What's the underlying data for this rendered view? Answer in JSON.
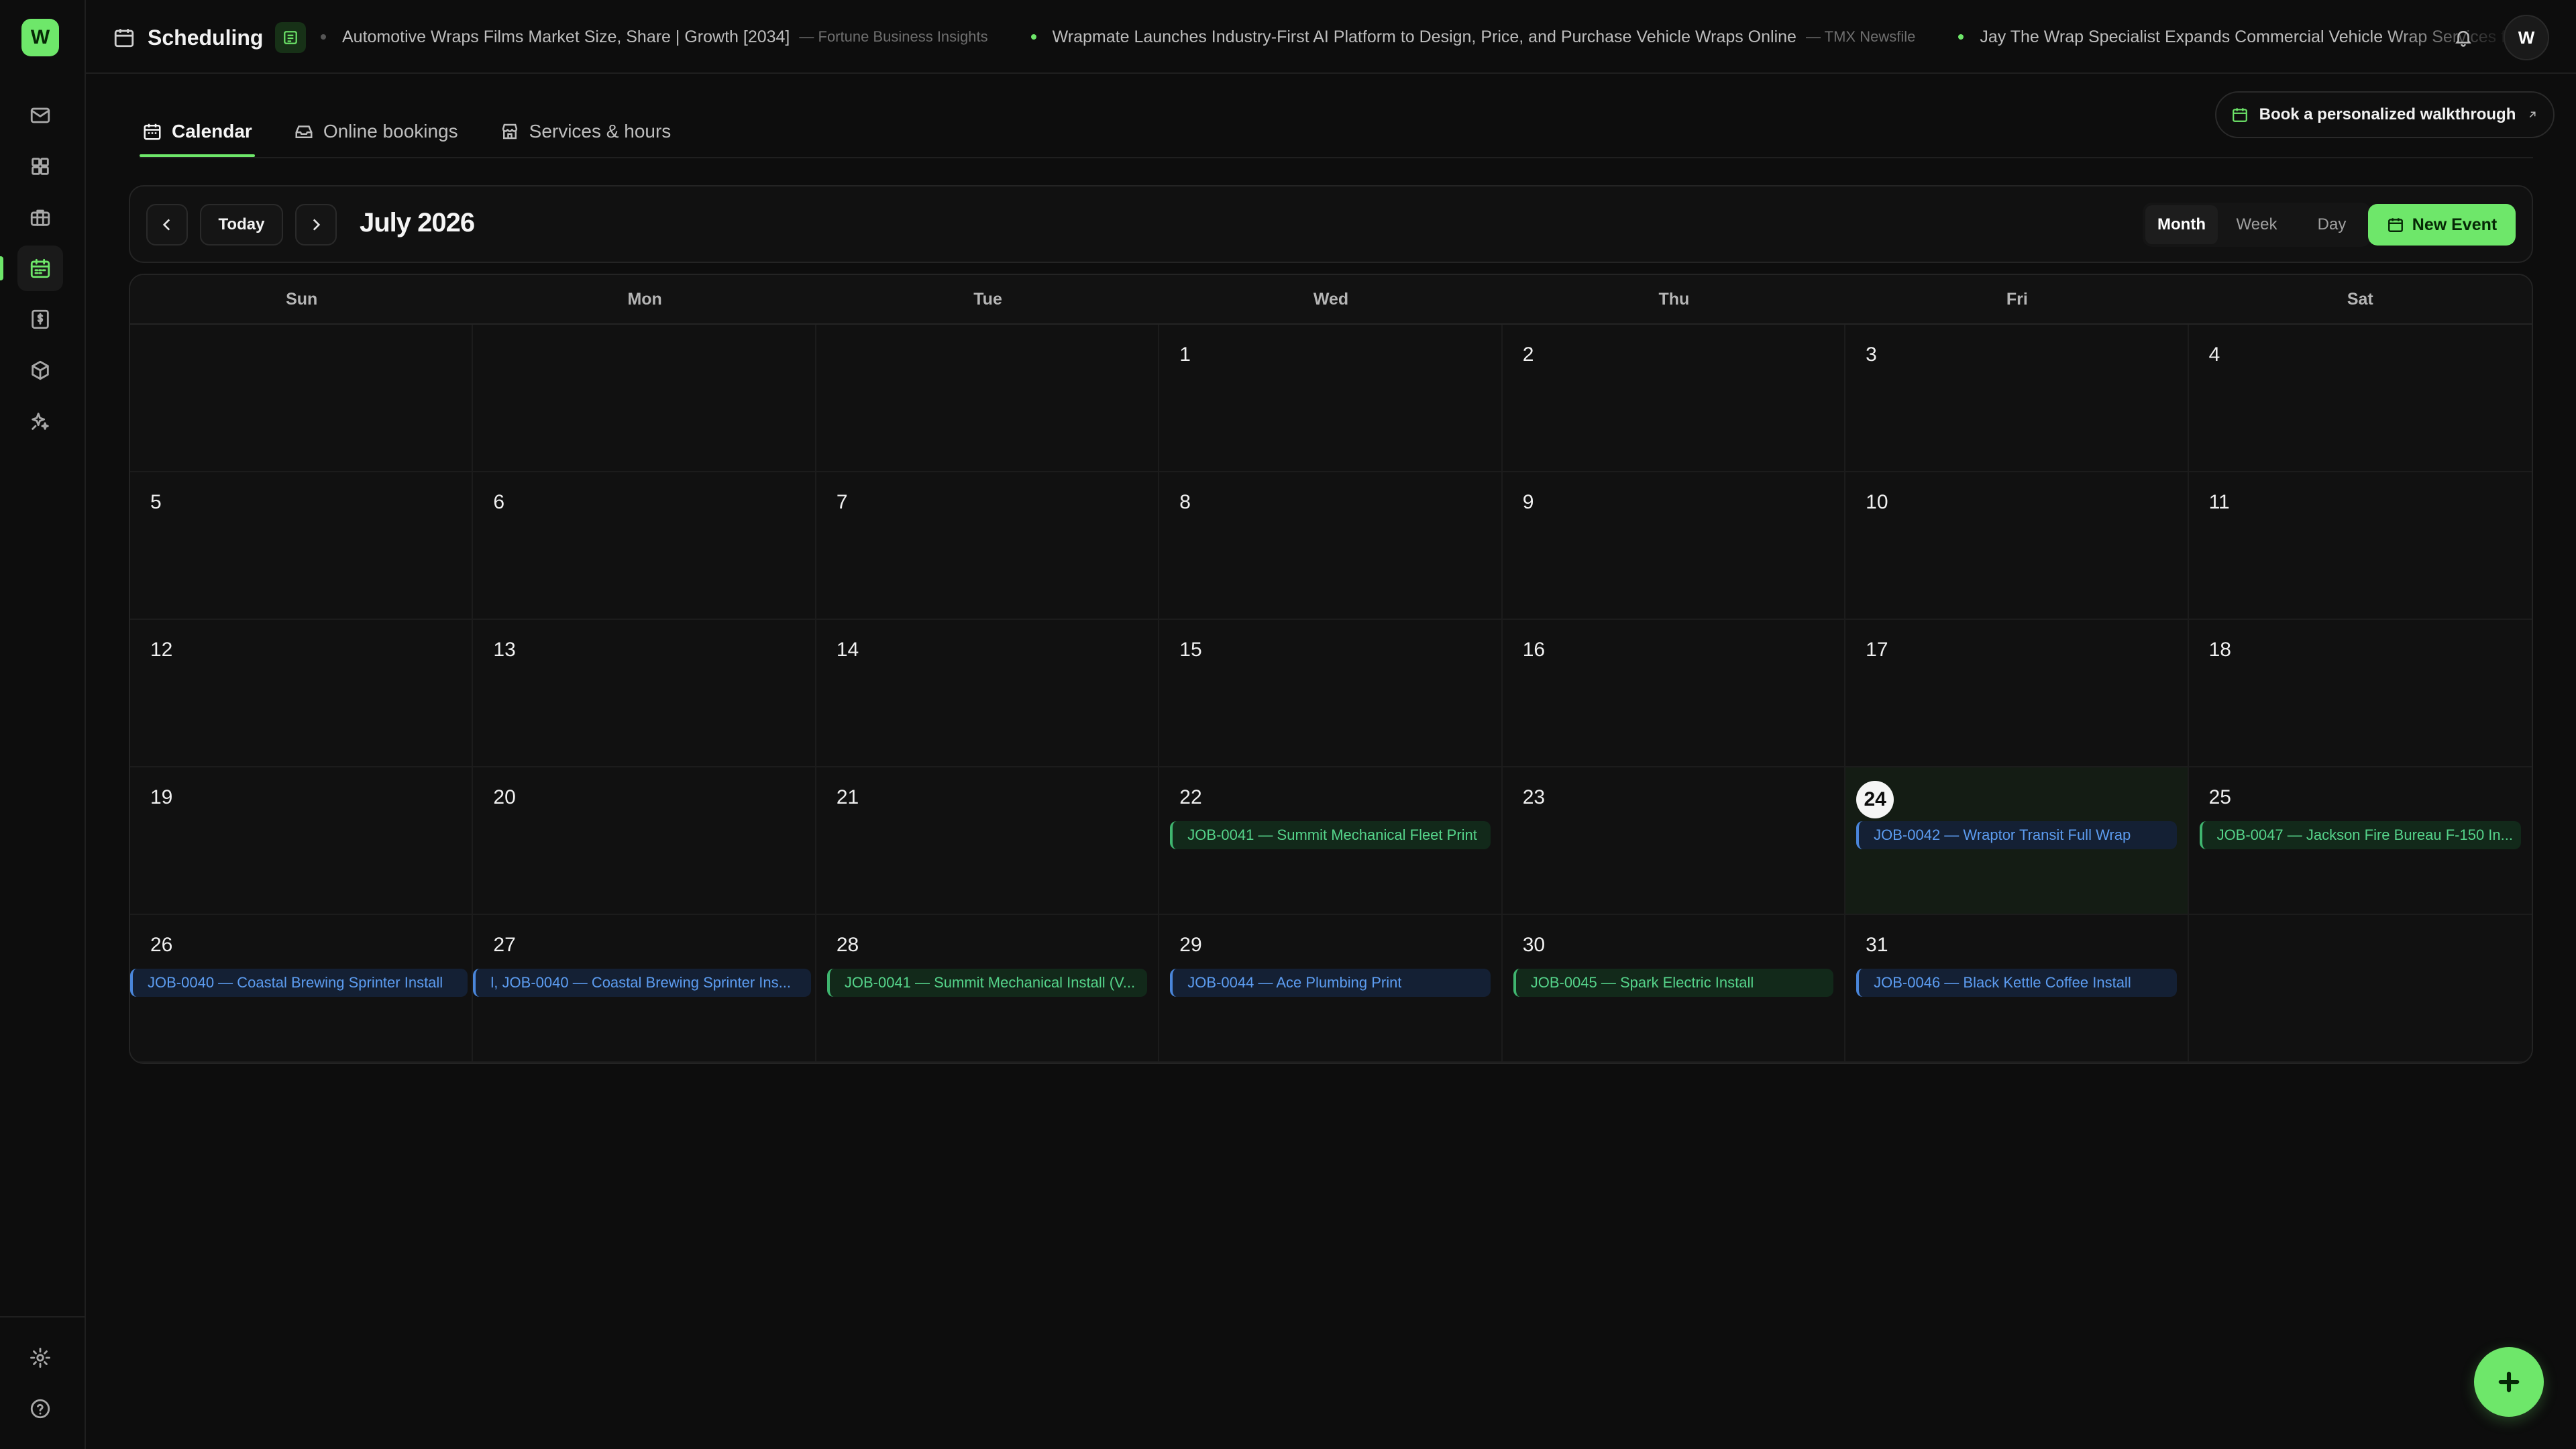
{
  "app": {
    "logo_letter": "W",
    "title": "Scheduling"
  },
  "sidebar": {
    "items": [
      {
        "name": "inbox",
        "icon": "mail-icon"
      },
      {
        "name": "dashboard",
        "icon": "grid-icon"
      },
      {
        "name": "jobs",
        "icon": "briefcase-icon"
      },
      {
        "name": "scheduling",
        "icon": "calendar-icon",
        "active": true
      },
      {
        "name": "invoices",
        "icon": "dollar-document-icon"
      },
      {
        "name": "inventory",
        "icon": "box-icon"
      },
      {
        "name": "ai-tools",
        "icon": "sparkles-icon"
      }
    ],
    "footer": [
      {
        "name": "settings",
        "icon": "gear-icon"
      },
      {
        "name": "help",
        "icon": "help-circle-icon"
      }
    ]
  },
  "header": {
    "news": [
      {
        "headline": "Automotive Wraps Films Market Size, Share | Growth [2034]",
        "source": "— Fortune Business Insights"
      },
      {
        "headline": "Wrapmate Launches Industry-First AI Platform to Design, Price, and Purchase Vehicle Wraps Online",
        "source": "— TMX Newsfile"
      },
      {
        "headline": "Jay The Wrap Specialist Expands Commercial Vehicle Wrap Services fo",
        "source": ""
      }
    ],
    "avatar_letter": "W"
  },
  "tabs": [
    {
      "label": "Calendar",
      "icon": "calendar-icon",
      "active": true
    },
    {
      "label": "Online bookings",
      "icon": "inbox-icon",
      "active": false
    },
    {
      "label": "Services & hours",
      "icon": "store-icon",
      "active": false
    }
  ],
  "walkthrough_label": "Book a personalized walkthrough",
  "toolbar": {
    "today_label": "Today",
    "month_label": "July 2026",
    "views": [
      "Month",
      "Week",
      "Day"
    ],
    "active_view": "Month",
    "new_event_label": "New Event"
  },
  "calendar": {
    "weekdays": [
      "Sun",
      "Mon",
      "Tue",
      "Wed",
      "Thu",
      "Fri",
      "Sat"
    ],
    "today": "24",
    "weeks": [
      [
        {
          "day": "",
          "events": []
        },
        {
          "day": "",
          "events": []
        },
        {
          "day": "",
          "events": []
        },
        {
          "day": "1",
          "events": []
        },
        {
          "day": "2",
          "events": []
        },
        {
          "day": "3",
          "events": []
        },
        {
          "day": "4",
          "events": []
        }
      ],
      [
        {
          "day": "5",
          "events": []
        },
        {
          "day": "6",
          "events": []
        },
        {
          "day": "7",
          "events": []
        },
        {
          "day": "8",
          "events": []
        },
        {
          "day": "9",
          "events": []
        },
        {
          "day": "10",
          "events": []
        },
        {
          "day": "11",
          "events": []
        }
      ],
      [
        {
          "day": "12",
          "events": []
        },
        {
          "day": "13",
          "events": []
        },
        {
          "day": "14",
          "events": []
        },
        {
          "day": "15",
          "events": []
        },
        {
          "day": "16",
          "events": []
        },
        {
          "day": "17",
          "events": []
        },
        {
          "day": "18",
          "events": []
        }
      ],
      [
        {
          "day": "19",
          "events": []
        },
        {
          "day": "20",
          "events": []
        },
        {
          "day": "21",
          "events": []
        },
        {
          "day": "22",
          "events": [
            {
              "title": "JOB-0041 — Summit Mechanical Fleet Print",
              "color": "green"
            }
          ]
        },
        {
          "day": "23",
          "events": []
        },
        {
          "day": "24",
          "events": [
            {
              "title": "JOB-0042 — Wraptor Transit Full Wrap",
              "color": "blue"
            }
          ]
        },
        {
          "day": "25",
          "events": [
            {
              "title": "JOB-0047 — Jackson Fire Bureau F-150 In...",
              "color": "green"
            }
          ]
        }
      ],
      [
        {
          "day": "26",
          "events": [
            {
              "title": "JOB-0040 — Coastal Brewing Sprinter Install",
              "color": "blue",
              "bleed": true
            }
          ]
        },
        {
          "day": "27",
          "events": [
            {
              "title": "l, JOB-0040 — Coastal Brewing Sprinter Ins...",
              "color": "blue",
              "bleed": true
            }
          ]
        },
        {
          "day": "28",
          "events": [
            {
              "title": "JOB-0041 — Summit Mechanical Install (V...",
              "color": "green"
            }
          ]
        },
        {
          "day": "29",
          "events": [
            {
              "title": "JOB-0044 — Ace Plumbing Print",
              "color": "blue"
            }
          ]
        },
        {
          "day": "30",
          "events": [
            {
              "title": "JOB-0045 — Spark Electric Install",
              "color": "green"
            }
          ]
        },
        {
          "day": "31",
          "events": [
            {
              "title": "JOB-0046 — Black Kettle Coffee Install",
              "color": "blue"
            }
          ]
        },
        {
          "day": "",
          "events": []
        }
      ]
    ]
  },
  "colors": {
    "accent": "#6ee76a",
    "background": "#0d0d0d",
    "event_green": "#55d38a",
    "event_blue": "#5c9cf0"
  }
}
